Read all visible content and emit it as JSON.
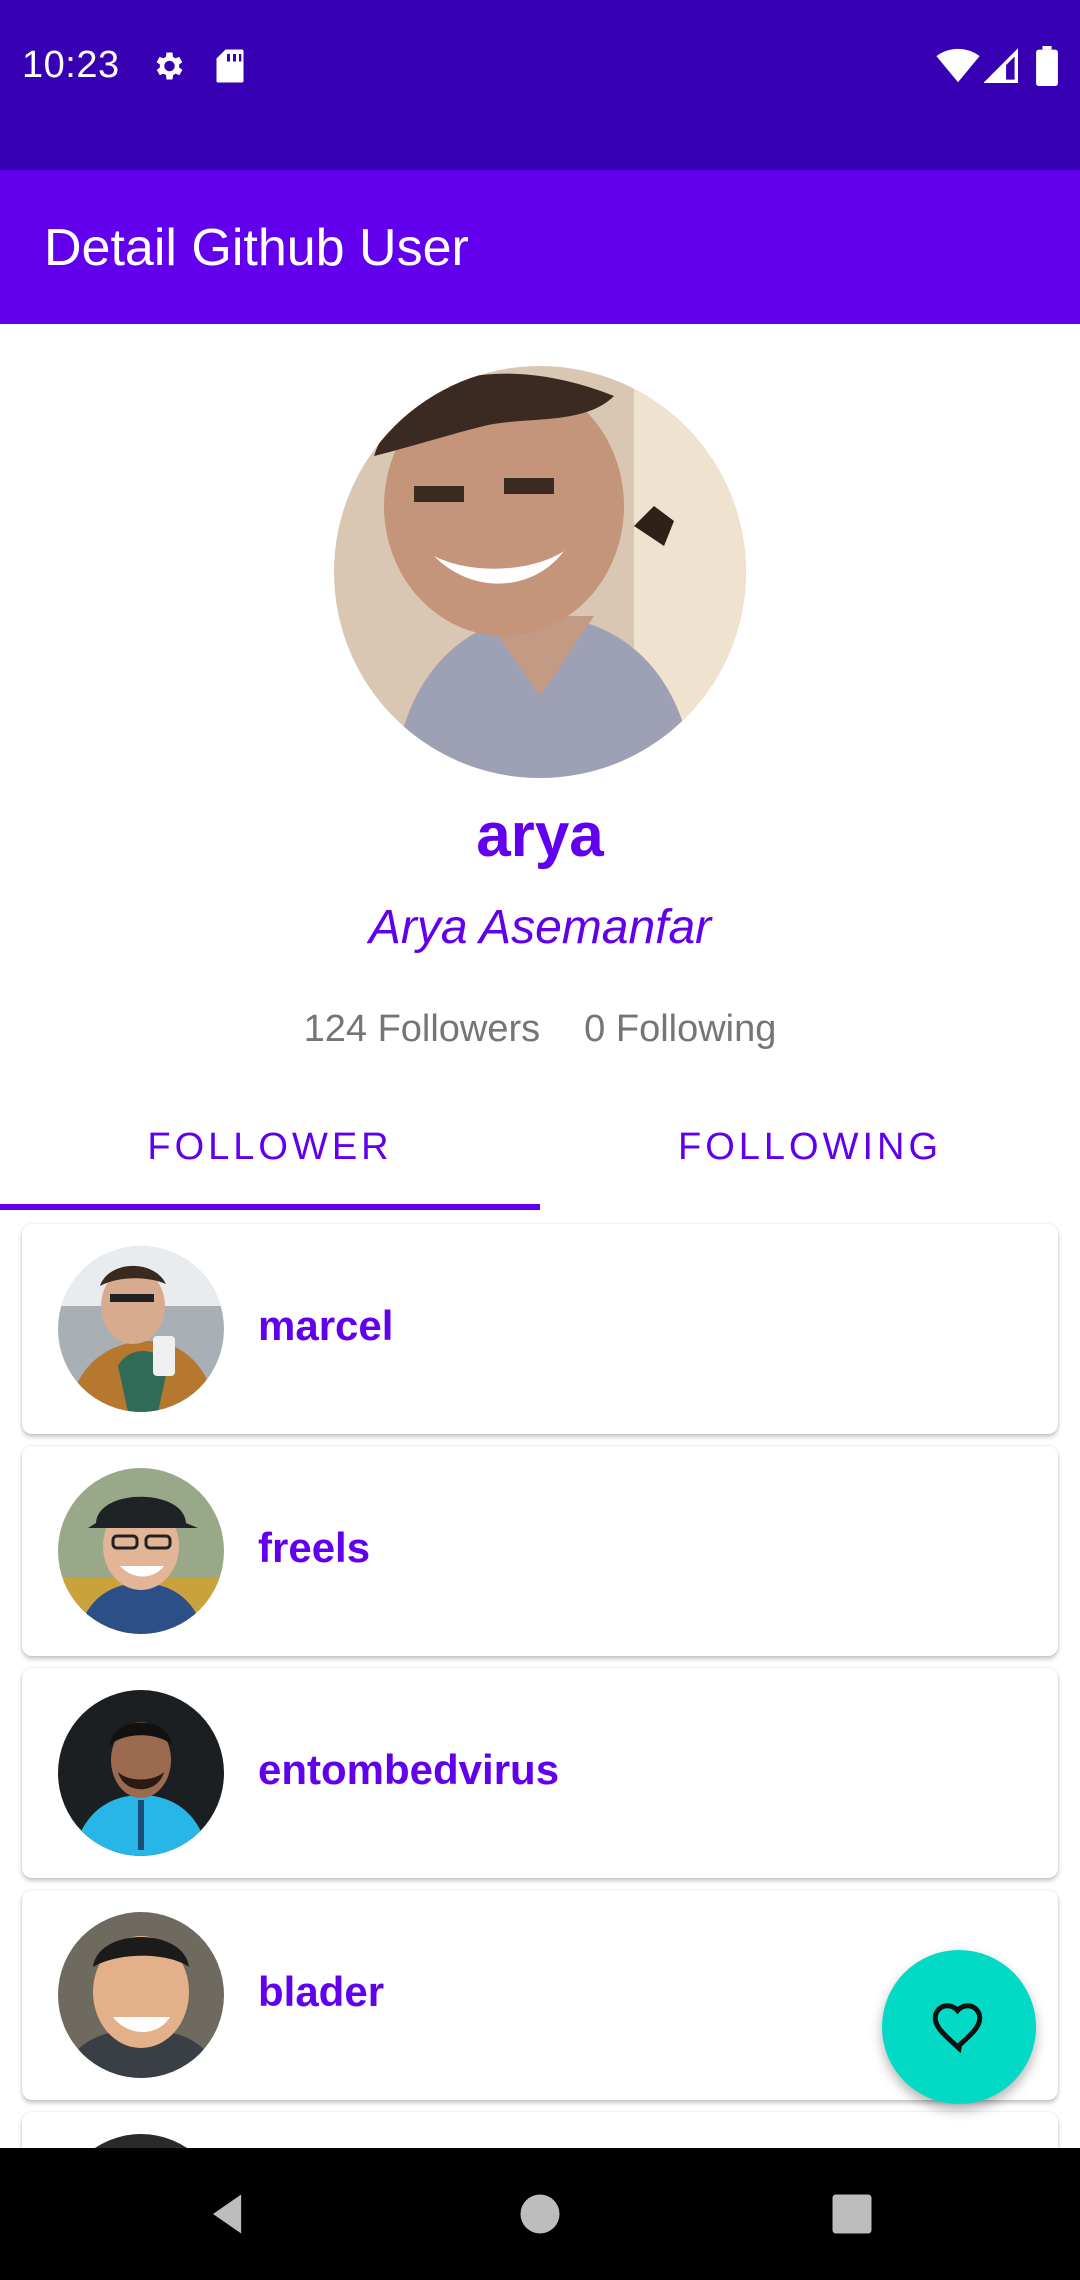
{
  "status_bar": {
    "time": "10:23"
  },
  "app_bar": {
    "title": "Detail Github User"
  },
  "profile": {
    "username": "arya",
    "full_name": "Arya Asemanfar",
    "followers": "124 Followers",
    "following": "0 Following"
  },
  "tabs": [
    {
      "label": "FOLLOWER",
      "selected": true
    },
    {
      "label": "FOLLOWING",
      "selected": false
    }
  ],
  "users": [
    {
      "login": "marcel"
    },
    {
      "login": "freels"
    },
    {
      "login": "entombedvirus"
    },
    {
      "login": "blader"
    }
  ],
  "colors": {
    "status_bar": "#3700B3",
    "primary": "#6200EE",
    "fab": "#03DAC5",
    "secondary_text": "#757575"
  },
  "icons": {
    "status": [
      "gear-icon",
      "sd-card-icon",
      "wifi-icon",
      "signal-icon",
      "battery-icon"
    ],
    "fab": "heart-outline-icon",
    "nav": [
      "back-icon",
      "home-icon",
      "recents-icon"
    ]
  }
}
